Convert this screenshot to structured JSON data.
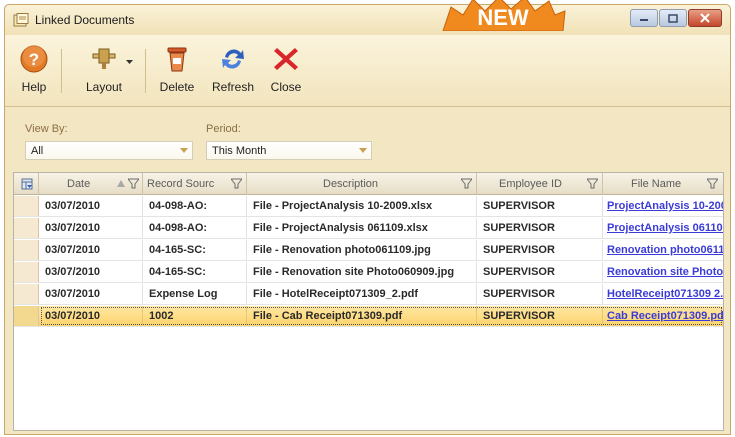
{
  "window": {
    "title": "Linked Documents",
    "badge": "NEW"
  },
  "toolbar": {
    "help_label": "Help",
    "layout_label": "Layout",
    "delete_label": "Delete",
    "refresh_label": "Refresh",
    "close_label": "Close"
  },
  "filters": {
    "view_by_label": "View By:",
    "view_by_value": "All",
    "period_label": "Period:",
    "period_value": "This Month"
  },
  "grid": {
    "columns": {
      "date": "Date",
      "record_source": "Record Sourc",
      "description": "Description",
      "employee_id": "Employee ID",
      "file_name": "File Name"
    },
    "rows": [
      {
        "date": "03/07/2010",
        "record_source": "04-098-AO:",
        "description": "File - ProjectAnalysis 10-2009.xlsx",
        "employee_id": "SUPERVISOR",
        "file_name": "ProjectAnalysis 10-200"
      },
      {
        "date": "03/07/2010",
        "record_source": "04-098-AO:",
        "description": "File - ProjectAnalysis 061109.xlsx",
        "employee_id": "SUPERVISOR",
        "file_name": "ProjectAnalysis 061109"
      },
      {
        "date": "03/07/2010",
        "record_source": "04-165-SC:",
        "description": "File - Renovation photo061109.jpg",
        "employee_id": "SUPERVISOR",
        "file_name": "Renovation photo0611"
      },
      {
        "date": "03/07/2010",
        "record_source": "04-165-SC:",
        "description": "File - Renovation site Photo060909.jpg",
        "employee_id": "SUPERVISOR",
        "file_name": "Renovation site Photo"
      },
      {
        "date": "03/07/2010",
        "record_source": "Expense Log",
        "description": "File - HotelReceipt071309_2.pdf",
        "employee_id": "SUPERVISOR",
        "file_name": "HotelReceipt071309 2."
      },
      {
        "date": "03/07/2010",
        "record_source": "1002",
        "description": "File - Cab Receipt071309.pdf",
        "employee_id": "SUPERVISOR",
        "file_name": "Cab Receipt071309.pdf"
      }
    ]
  },
  "colors": {
    "ribbon_bg": "#f2e4bd",
    "selected_row": "#fcd46b",
    "link": "#3b3bd8",
    "close_icon": "#d8262a",
    "refresh_icon": "#2f5fbd"
  },
  "icons": [
    "document-link-icon",
    "help-icon",
    "layout-icon",
    "delete-icon",
    "refresh-icon",
    "close-icon",
    "filter-icon",
    "chevron-down-icon"
  ]
}
